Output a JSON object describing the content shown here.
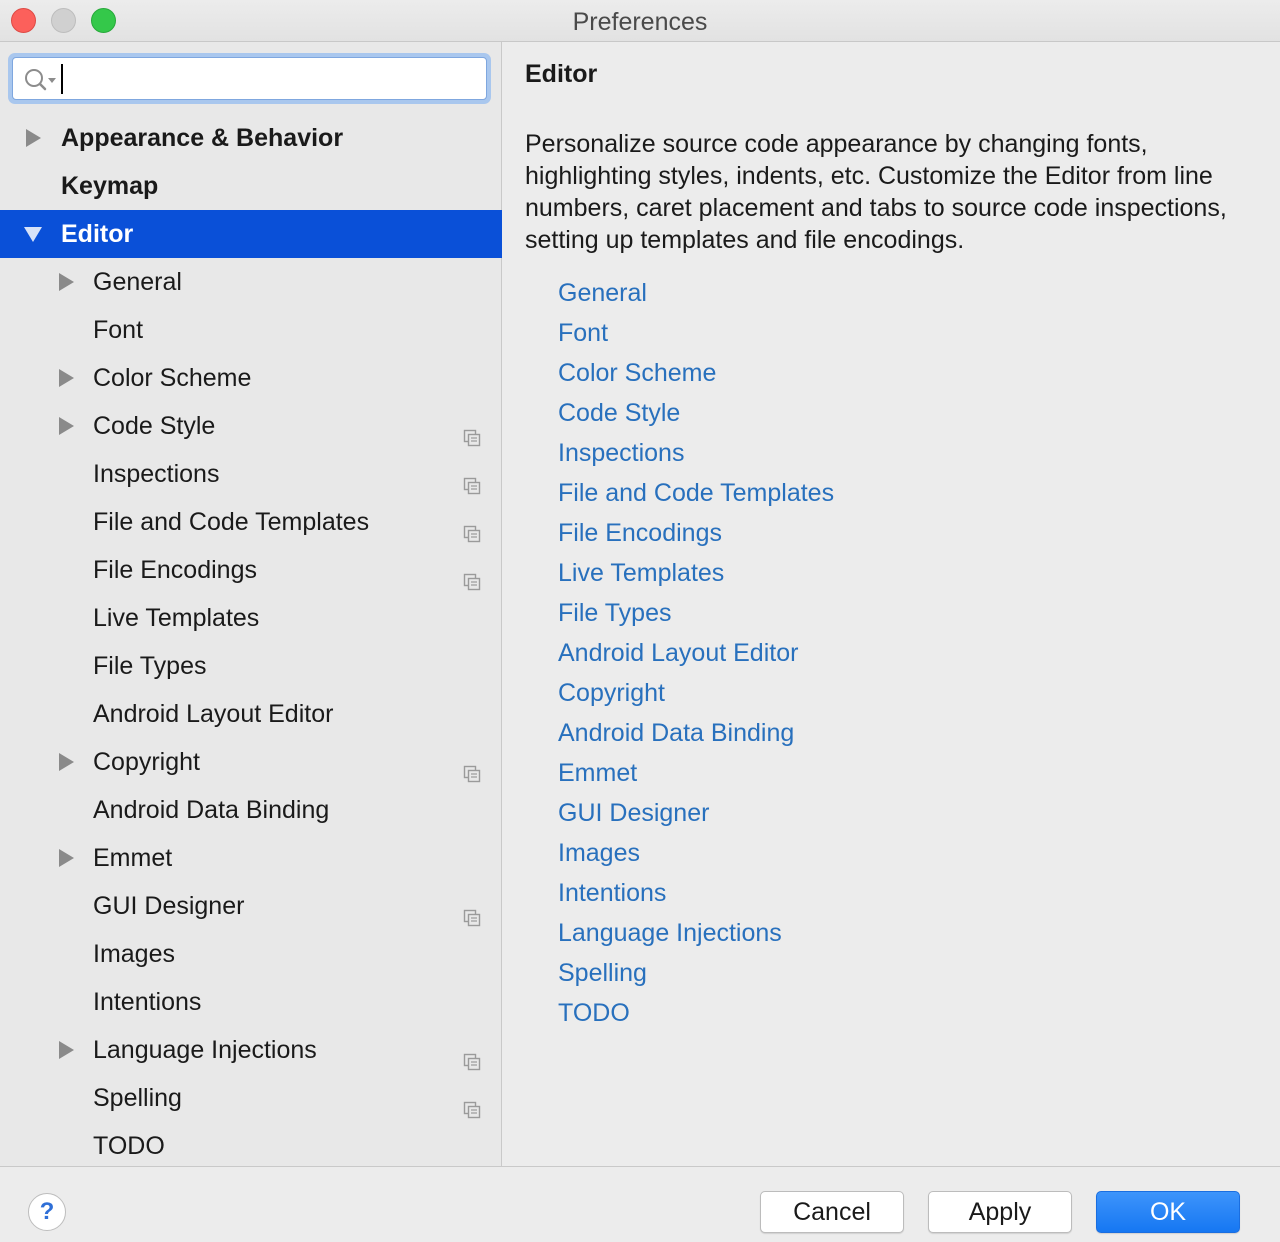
{
  "window": {
    "title": "Preferences"
  },
  "search": {
    "value": "",
    "placeholder": ""
  },
  "sidebar": {
    "top_items": [
      {
        "label": "Appearance & Behavior",
        "expandable": true
      },
      {
        "label": "Keymap",
        "expandable": false
      },
      {
        "label": "Editor",
        "expandable": true,
        "expanded": true,
        "selected": true
      }
    ],
    "editor_children": [
      {
        "label": "General",
        "expandable": true,
        "project_icon": false
      },
      {
        "label": "Font",
        "expandable": false,
        "project_icon": false
      },
      {
        "label": "Color Scheme",
        "expandable": true,
        "project_icon": false
      },
      {
        "label": "Code Style",
        "expandable": true,
        "project_icon": true
      },
      {
        "label": "Inspections",
        "expandable": false,
        "project_icon": true
      },
      {
        "label": "File and Code Templates",
        "expandable": false,
        "project_icon": true
      },
      {
        "label": "File Encodings",
        "expandable": false,
        "project_icon": true
      },
      {
        "label": "Live Templates",
        "expandable": false,
        "project_icon": false
      },
      {
        "label": "File Types",
        "expandable": false,
        "project_icon": false
      },
      {
        "label": "Android Layout Editor",
        "expandable": false,
        "project_icon": false
      },
      {
        "label": "Copyright",
        "expandable": true,
        "project_icon": true
      },
      {
        "label": "Android Data Binding",
        "expandable": false,
        "project_icon": false
      },
      {
        "label": "Emmet",
        "expandable": true,
        "project_icon": false
      },
      {
        "label": "GUI Designer",
        "expandable": false,
        "project_icon": true
      },
      {
        "label": "Images",
        "expandable": false,
        "project_icon": false
      },
      {
        "label": "Intentions",
        "expandable": false,
        "project_icon": false
      },
      {
        "label": "Language Injections",
        "expandable": true,
        "project_icon": true
      },
      {
        "label": "Spelling",
        "expandable": false,
        "project_icon": true
      },
      {
        "label": "TODO",
        "expandable": false,
        "project_icon": false
      }
    ]
  },
  "content": {
    "title": "Editor",
    "description": "Personalize source code appearance by changing fonts, highlighting styles, indents, etc. Customize the Editor from line numbers, caret placement and tabs to source code inspections, setting up templates and file encodings.",
    "links": [
      "General",
      "Font",
      "Color Scheme",
      "Code Style",
      "Inspections",
      "File and Code Templates",
      "File Encodings",
      "Live Templates",
      "File Types",
      "Android Layout Editor",
      "Copyright",
      "Android Data Binding",
      "Emmet",
      "GUI Designer",
      "Images",
      "Intentions",
      "Language Injections",
      "Spelling",
      "TODO"
    ]
  },
  "footer": {
    "help_label": "?",
    "cancel_label": "Cancel",
    "apply_label": "Apply",
    "ok_label": "OK"
  },
  "colors": {
    "selection": "#0a50d8",
    "link": "#2870bd",
    "ok_button": "#1677f2"
  }
}
